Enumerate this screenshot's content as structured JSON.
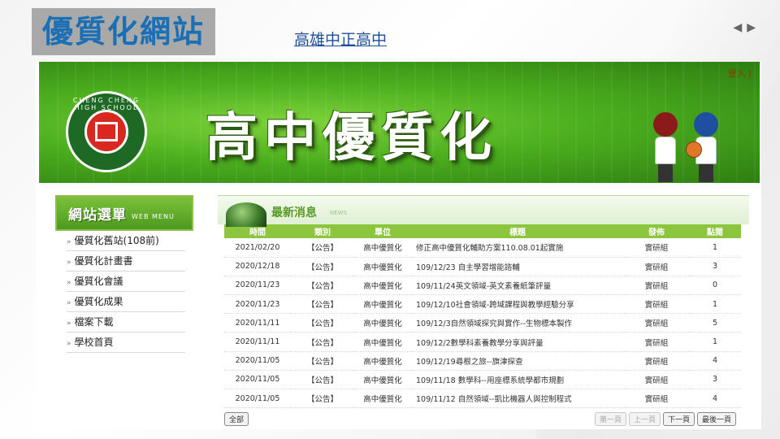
{
  "slide": {
    "title": "優質化網站",
    "link_text": "高雄中正高中",
    "nav_prev": "◀",
    "nav_next": "▶"
  },
  "banner": {
    "login": "登入 |",
    "title": "高中優質化",
    "logo_ring_text": "CHENG CHENG HIGH SCHOOL"
  },
  "sidebar": {
    "header_zh": "網站選單",
    "header_en": "WEB MENU",
    "items": [
      {
        "label": "優質化舊站(108前)"
      },
      {
        "label": "優質化計畫書"
      },
      {
        "label": "優質化會議"
      },
      {
        "label": "優質化成果"
      },
      {
        "label": "檔案下載"
      },
      {
        "label": "學校首頁"
      }
    ]
  },
  "news": {
    "title": "最新消息",
    "title_en": "NEWS",
    "columns": [
      "時間",
      "類別",
      "單位",
      "標題",
      "發佈",
      "點閱"
    ],
    "rows": [
      {
        "date": "2021/02/20",
        "category": "【公告】",
        "unit": "高中優質化",
        "title": "修正高中優質化輔助方案110.08.01起實施",
        "publisher": "實研組",
        "views": "1"
      },
      {
        "date": "2020/12/18",
        "category": "【公告】",
        "unit": "高中優質化",
        "title": "109/12/23 自主學習增能諮輔",
        "publisher": "實研組",
        "views": "3"
      },
      {
        "date": "2020/11/23",
        "category": "【公告】",
        "unit": "高中優質化",
        "title": "109/11/24英文領域-英文素養紙筆評量",
        "publisher": "實研組",
        "views": "0"
      },
      {
        "date": "2020/11/23",
        "category": "【公告】",
        "unit": "高中優質化",
        "title": "109/12/10社會領域-跨域課程與教學經驗分享",
        "publisher": "實研組",
        "views": "1"
      },
      {
        "date": "2020/11/11",
        "category": "【公告】",
        "unit": "高中優質化",
        "title": "109/12/3自然領域探究與實作--生物標本製作",
        "publisher": "實研組",
        "views": "5"
      },
      {
        "date": "2020/11/11",
        "category": "【公告】",
        "unit": "高中優質化",
        "title": "109/12/2數學科素養教學分享與評量",
        "publisher": "實研組",
        "views": "1"
      },
      {
        "date": "2020/11/05",
        "category": "【公告】",
        "unit": "高中優質化",
        "title": "109/12/19尋根之旅--旗津探查",
        "publisher": "實研組",
        "views": "4"
      },
      {
        "date": "2020/11/05",
        "category": "【公告】",
        "unit": "高中優質化",
        "title": "109/11/18 數學科--用座標系統學都市規劃",
        "publisher": "實研組",
        "views": "3"
      },
      {
        "date": "2020/11/05",
        "category": "【公告】",
        "unit": "高中優質化",
        "title": "109/11/12 自然領域--凱比機器人與控制程式",
        "publisher": "實研組",
        "views": "4"
      }
    ],
    "all_button": "全部",
    "pager": {
      "first": "第一頁",
      "prev": "上一頁",
      "next": "下一頁",
      "last": "最後一頁"
    }
  }
}
